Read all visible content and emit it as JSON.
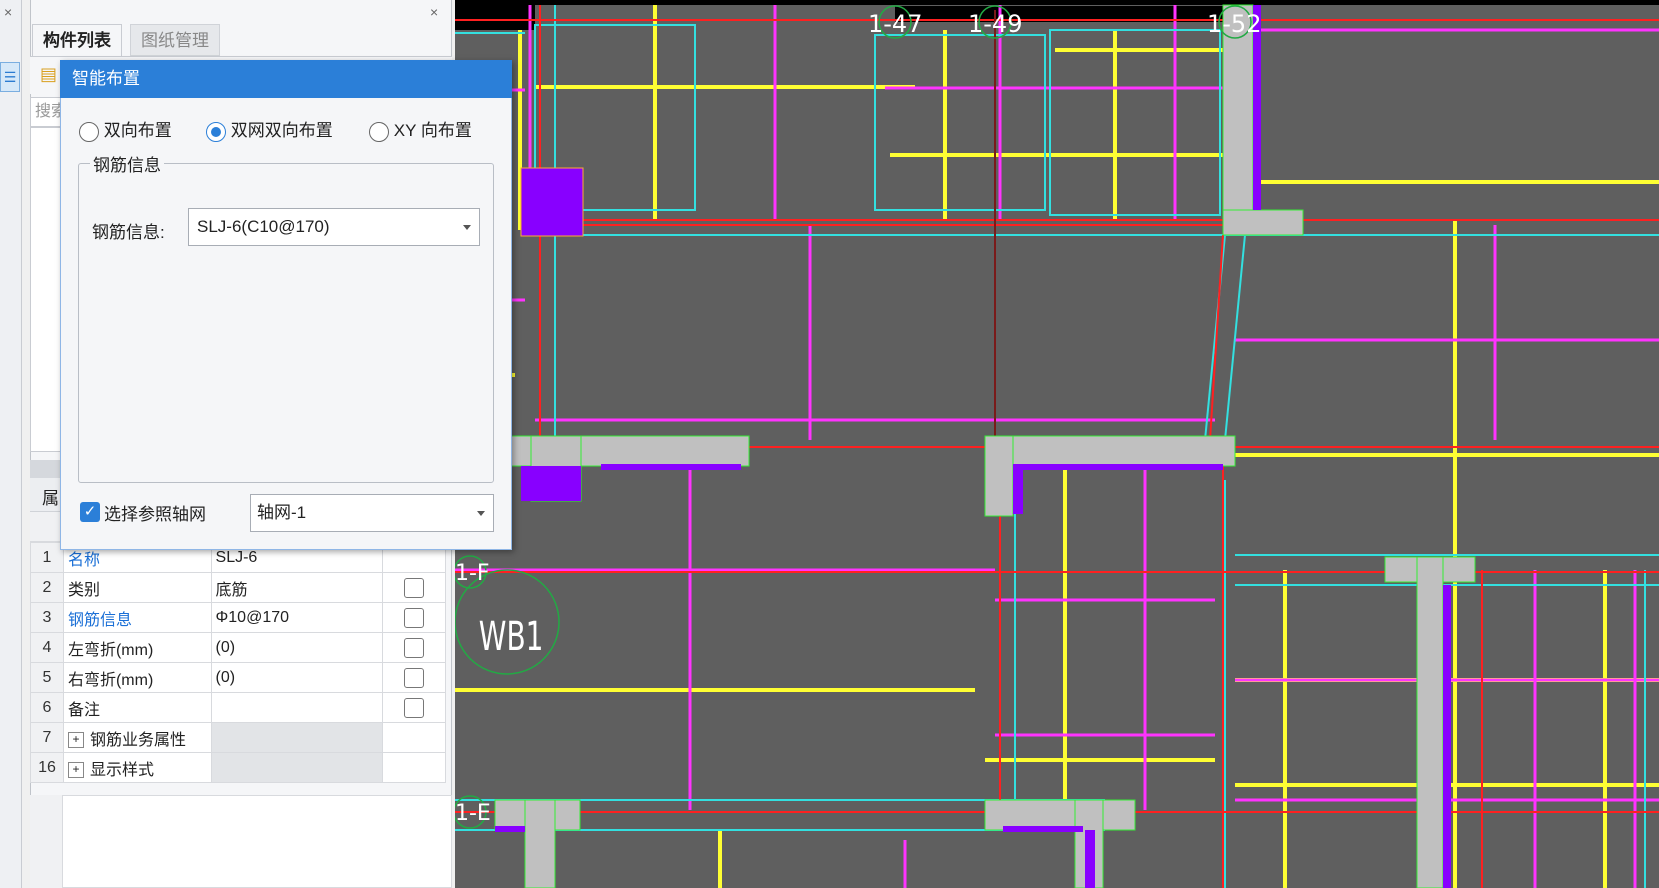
{
  "tabs": {
    "component_list": "构件列表",
    "drawing_manage": "图纸管理"
  },
  "search_placeholder": "搜索",
  "properties_header": "属",
  "dialog": {
    "title": "智能布置",
    "options": {
      "bidirectional": "双向布置",
      "dual_net": "双网双向布置",
      "xy": "XY 向布置"
    },
    "selected_option": "双网双向布置",
    "group_title": "钢筋信息",
    "rebar_label": "钢筋信息:",
    "rebar_value": "SLJ-6(C10@170)",
    "axis_checkbox_label": "选择参照轴网",
    "axis_checked": true,
    "axis_value": "轴网-1"
  },
  "properties": [
    {
      "num": "1",
      "name": "名称",
      "value": "SLJ-6"
    },
    {
      "num": "2",
      "name": "类别",
      "value": "底筋"
    },
    {
      "num": "3",
      "name": "钢筋信息",
      "value": "Φ10@170"
    },
    {
      "num": "4",
      "name": "左弯折(mm)",
      "value": "(0)"
    },
    {
      "num": "5",
      "name": "右弯折(mm)",
      "value": "(0)"
    },
    {
      "num": "6",
      "name": "备注",
      "value": ""
    },
    {
      "num": "7",
      "name": "钢筋业务属性",
      "value": ""
    },
    {
      "num": "16",
      "name": "显示样式",
      "value": ""
    }
  ],
  "cad": {
    "axis_labels": [
      "1-47",
      "1-49",
      "1-52",
      "1-F",
      "1-E"
    ],
    "slab_label": "WB1"
  },
  "colors": {
    "canvas_bg": "#5f5f5f",
    "yellow": "#ffff33",
    "magenta": "#ff33ff",
    "cyan": "#33e0e0",
    "red": "#ff2020",
    "accent": "#2b7fd8"
  },
  "icons": {
    "close": "close-icon",
    "new": "new-component-icon",
    "expand": "plus-icon",
    "dropdown": "chevron-down-icon"
  }
}
